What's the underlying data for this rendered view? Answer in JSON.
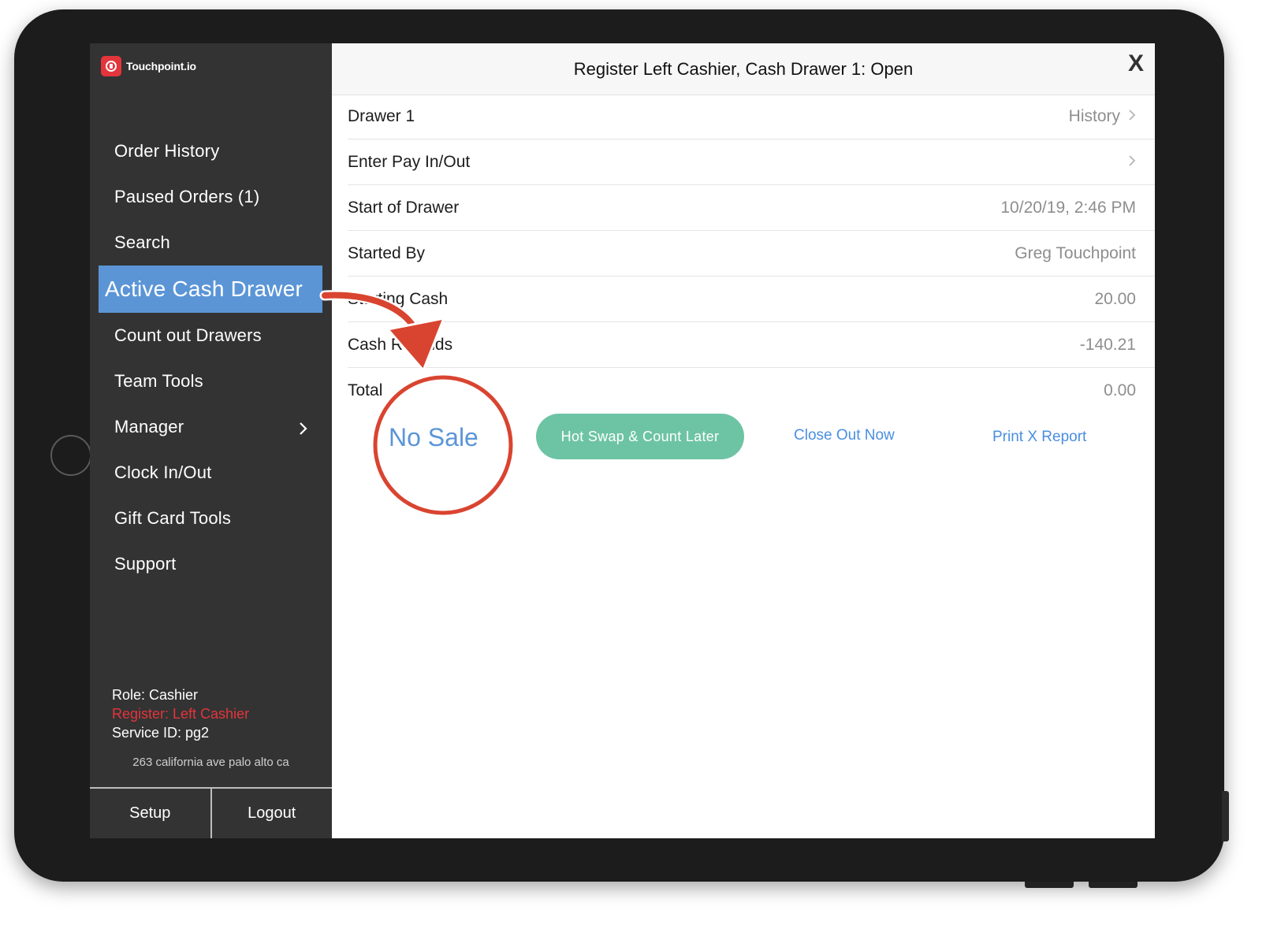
{
  "app": {
    "logo_text": "Touchpoint.io"
  },
  "sidebar": {
    "items": [
      {
        "label": "Order History"
      },
      {
        "label": "Paused Orders (1)"
      },
      {
        "label": "Search"
      },
      {
        "label": "Active Cash Drawer",
        "active": true
      },
      {
        "label": "Count out Drawers"
      },
      {
        "label": "Team Tools"
      },
      {
        "label": "Manager",
        "has_submenu": true
      },
      {
        "label": "Clock In/Out"
      },
      {
        "label": "Gift Card Tools"
      },
      {
        "label": "Support"
      }
    ],
    "role": "Role: Cashier",
    "register": "Register: Left Cashier",
    "service_id": "Service ID: pg2",
    "address": "263 california ave palo alto ca",
    "setup_label": "Setup",
    "logout_label": "Logout"
  },
  "header": {
    "title": "Register Left Cashier, Cash Drawer 1: Open",
    "close_label": "X"
  },
  "rows": [
    {
      "label": "Drawer 1",
      "value": "History",
      "chevron": true
    },
    {
      "label": "Enter Pay In/Out",
      "value": "",
      "chevron": true
    },
    {
      "label": "Start of Drawer",
      "value": "10/20/19, 2:46 PM"
    },
    {
      "label": "Started By",
      "value": "Greg Touchpoint"
    },
    {
      "label": "Starting Cash",
      "value": "20.00"
    },
    {
      "label": "Cash Refunds",
      "value": "-140.21"
    },
    {
      "label": "Total",
      "value": "0.00"
    }
  ],
  "actions": {
    "no_sale": "No Sale",
    "hot_swap": "Hot Swap & Count Later",
    "close_out": "Close Out Now",
    "print_x": "Print X Report"
  },
  "colors": {
    "sidebar_bg": "#333333",
    "active_item": "#5b95d6",
    "register_text": "#e3353c",
    "hot_swap_button": "#6dc4a4",
    "link_blue": "#4a8ee0",
    "annotation_red": "#d94430"
  },
  "icons": [
    "touchpoint-logo-icon",
    "chevron-right-icon",
    "close-icon",
    "home-button",
    "annotation-arrow",
    "annotation-circle"
  ]
}
